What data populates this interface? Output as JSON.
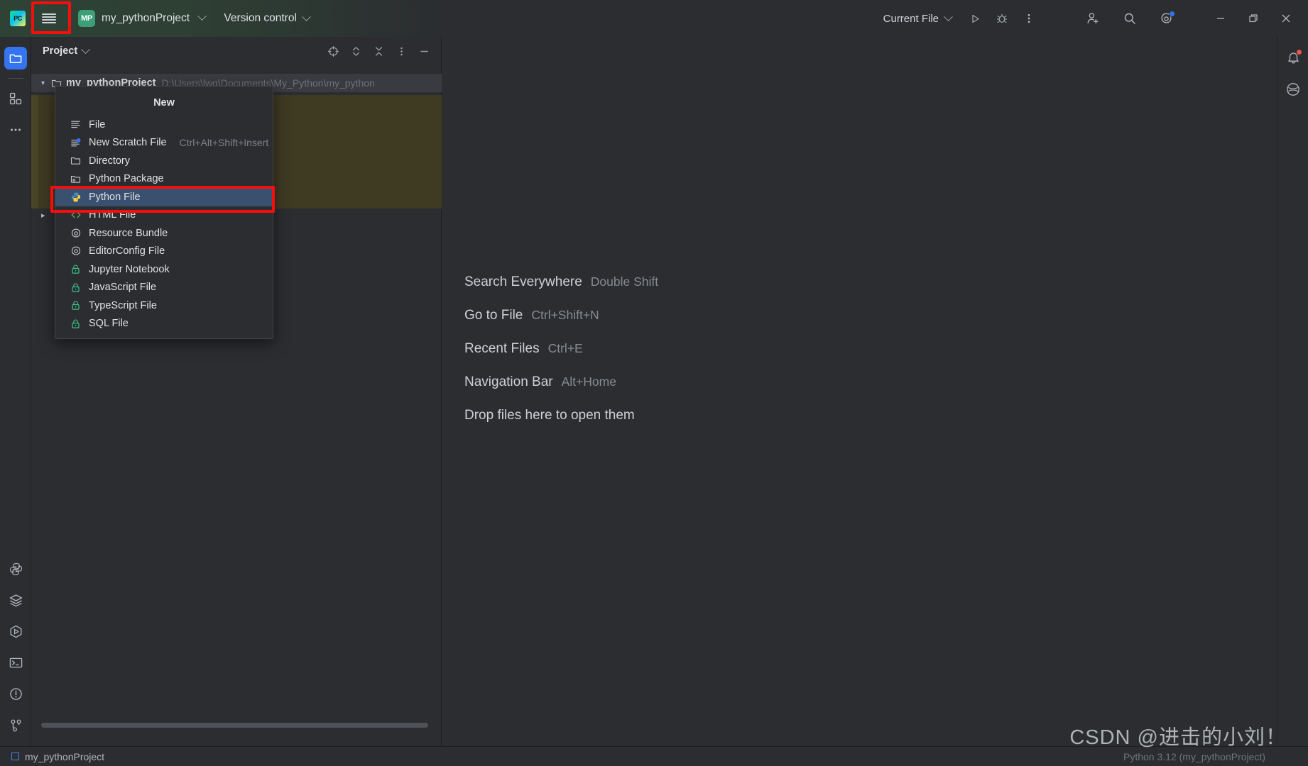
{
  "titlebar": {
    "logo": "pycharm-logo",
    "menu_icon": "hamburger-menu-icon",
    "project_badge": "MP",
    "project_name": "my_pythonProject",
    "version_control": "Version control",
    "run_config": "Current File",
    "run_icon": "run-icon",
    "debug_icon": "debug-icon",
    "more_icon": "more-vertical-icon",
    "account_icon": "add-user-icon",
    "search_icon": "search-icon",
    "settings_icon": "gear-icon",
    "minimize": "minimize-icon",
    "maximize": "maximize-icon",
    "close": "close-icon"
  },
  "left_rail": {
    "items": [
      {
        "name": "project-tool-window",
        "icon": "folder-icon",
        "active": true
      },
      {
        "name": "structure-tool-window",
        "icon": "structure-grid-icon",
        "active": false
      },
      {
        "name": "more-tool-windows",
        "icon": "more-horizontal-icon",
        "active": false
      }
    ],
    "bottom_items": [
      {
        "name": "python-console",
        "icon": "python-icon"
      },
      {
        "name": "services",
        "icon": "layers-icon"
      },
      {
        "name": "run-tool-window",
        "icon": "run-hexagon-icon"
      },
      {
        "name": "terminal-tool-window",
        "icon": "terminal-icon"
      },
      {
        "name": "problems-tool-window",
        "icon": "warning-circle-icon"
      },
      {
        "name": "version-control-tool-window",
        "icon": "git-branch-icon"
      }
    ]
  },
  "right_rail": {
    "items": [
      {
        "name": "notifications",
        "icon": "bell-icon",
        "badge": true
      },
      {
        "name": "ai-assistant",
        "icon": "ai-assistant-icon",
        "badge": false
      }
    ]
  },
  "project_panel": {
    "title": "Project",
    "title_chevron": "chevron-down-icon",
    "actions": [
      {
        "name": "select-opened-file",
        "icon": "crosshair-icon"
      },
      {
        "name": "expand-collapse",
        "icon": "expand-collapse-icon"
      },
      {
        "name": "collapse-all",
        "icon": "collapse-all-icon"
      },
      {
        "name": "options-menu",
        "icon": "more-vertical-icon"
      },
      {
        "name": "hide-panel",
        "icon": "minimize-icon"
      }
    ],
    "tree": [
      {
        "label": "my_pythonProject",
        "path": "D:\\Users\\lwg\\Documents\\My_Python\\my_python",
        "expanded": true,
        "selected": true
      }
    ]
  },
  "new_popup": {
    "title": "New",
    "items": [
      {
        "label": "File",
        "icon": "file-lines-icon",
        "shortcut": "",
        "selected": false
      },
      {
        "label": "New Scratch File",
        "icon": "scratch-file-icon",
        "shortcut": "Ctrl+Alt+Shift+Insert",
        "selected": false
      },
      {
        "label": "Directory",
        "icon": "folder-icon",
        "shortcut": "",
        "selected": false
      },
      {
        "label": "Python Package",
        "icon": "python-package-icon",
        "shortcut": "",
        "selected": false
      },
      {
        "label": "Python File",
        "icon": "python-file-icon",
        "shortcut": "",
        "selected": true
      },
      {
        "label": "HTML File",
        "icon": "html-file-icon",
        "shortcut": "",
        "selected": false
      },
      {
        "label": "Resource Bundle",
        "icon": "gear-icon",
        "shortcut": "",
        "selected": false
      },
      {
        "label": "EditorConfig File",
        "icon": "gear-icon",
        "shortcut": "",
        "selected": false
      },
      {
        "label": "Jupyter Notebook",
        "icon": "lock-icon",
        "shortcut": "",
        "selected": false
      },
      {
        "label": "JavaScript File",
        "icon": "lock-icon",
        "shortcut": "",
        "selected": false
      },
      {
        "label": "TypeScript File",
        "icon": "lock-icon",
        "shortcut": "",
        "selected": false
      },
      {
        "label": "SQL File",
        "icon": "lock-icon",
        "shortcut": "",
        "selected": false
      }
    ]
  },
  "editor_empty_state": {
    "rows": [
      {
        "label": "Search Everywhere",
        "shortcut": "Double Shift"
      },
      {
        "label": "Go to File",
        "shortcut": "Ctrl+Shift+N"
      },
      {
        "label": "Recent Files",
        "shortcut": "Ctrl+E"
      },
      {
        "label": "Navigation Bar",
        "shortcut": "Alt+Home"
      },
      {
        "label": "Drop files here to open them",
        "shortcut": ""
      }
    ]
  },
  "statusbar": {
    "project": "my_pythonProject",
    "interpreter": "Python 3.12 (my_pythonProject)"
  },
  "watermark": "CSDN @进击的小刘！",
  "colors": {
    "background": "#2b2d30",
    "selection_blue": "#39506e",
    "accent_blue": "#3574f0",
    "highlight_red": "#f60e0e",
    "lock_green": "#3ec48b",
    "text_primary": "#dfe1e5",
    "text_muted": "#7e8289"
  }
}
